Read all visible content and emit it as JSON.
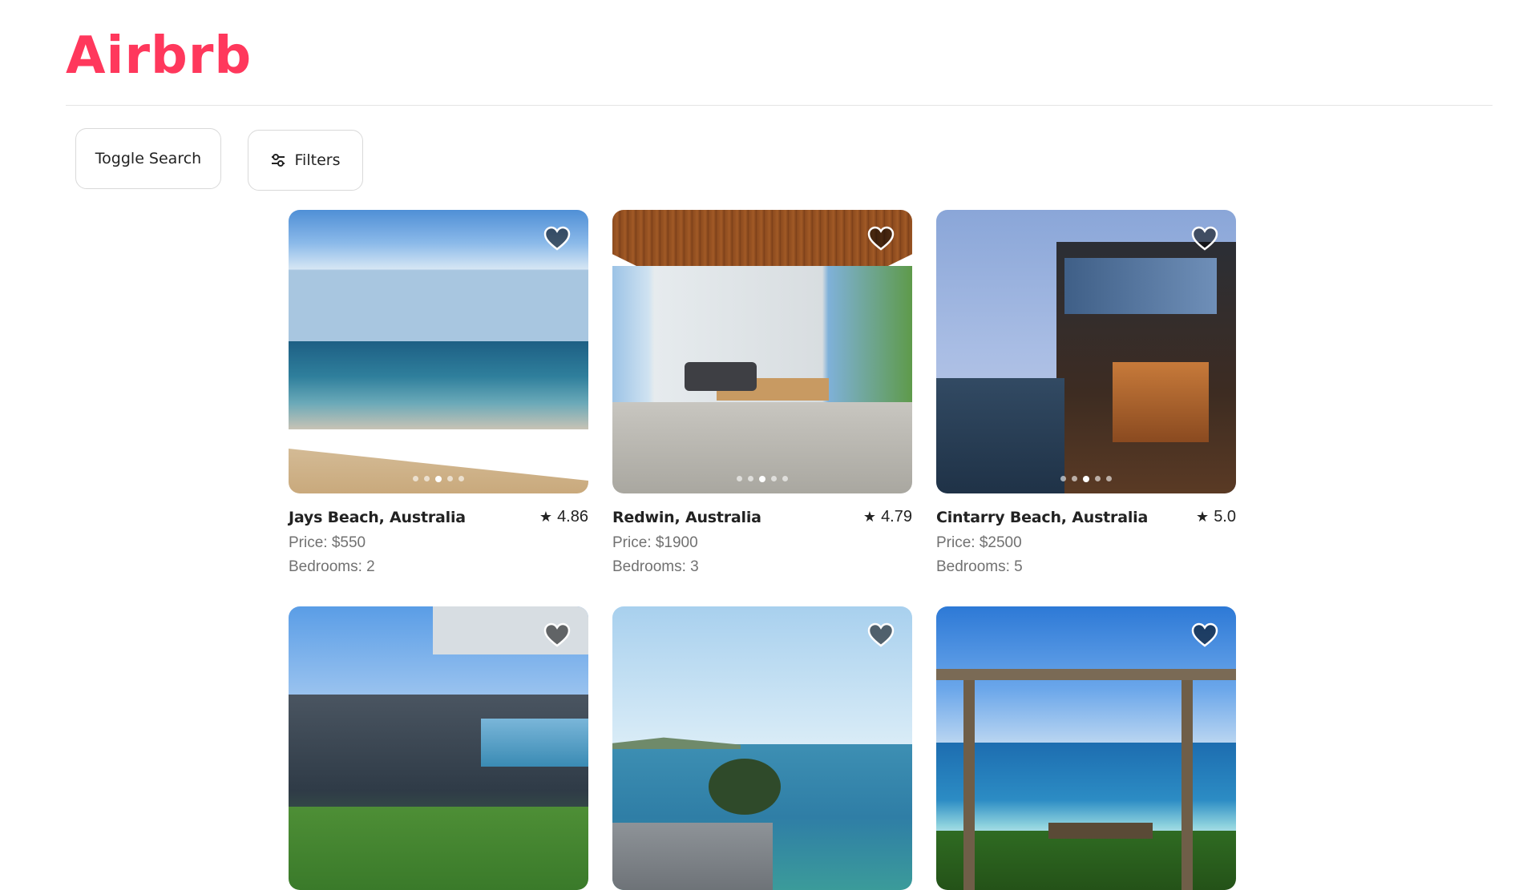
{
  "app": {
    "logo": "Airbrb",
    "brand_color": "#ff385c"
  },
  "toolbar": {
    "toggle_search_label": "Toggle Search",
    "filters_label": "Filters",
    "filters_icon": "sliders-icon"
  },
  "listings": [
    {
      "title": "Jays Beach, Australia",
      "rating": "4.86",
      "price": "Price: $550",
      "bedrooms": "Bedrooms: 2",
      "photo_index": 3,
      "photo_count": 5
    },
    {
      "title": "Redwin, Australia",
      "rating": "4.79",
      "price": "Price: $1900",
      "bedrooms": "Bedrooms: 3",
      "photo_index": 3,
      "photo_count": 5
    },
    {
      "title": "Cintarry Beach, Australia",
      "rating": "5.0",
      "price": "Price: $2500",
      "bedrooms": "Bedrooms: 5",
      "photo_index": 3,
      "photo_count": 5
    },
    {
      "title": "",
      "rating": "",
      "price": "",
      "bedrooms": "",
      "photo_index": 0,
      "photo_count": 0
    },
    {
      "title": "",
      "rating": "",
      "price": "",
      "bedrooms": "",
      "photo_index": 0,
      "photo_count": 0
    },
    {
      "title": "",
      "rating": "",
      "price": "",
      "bedrooms": "",
      "photo_index": 0,
      "photo_count": 0
    }
  ],
  "icons": {
    "favorite": "heart-icon",
    "rating": "star-icon"
  }
}
